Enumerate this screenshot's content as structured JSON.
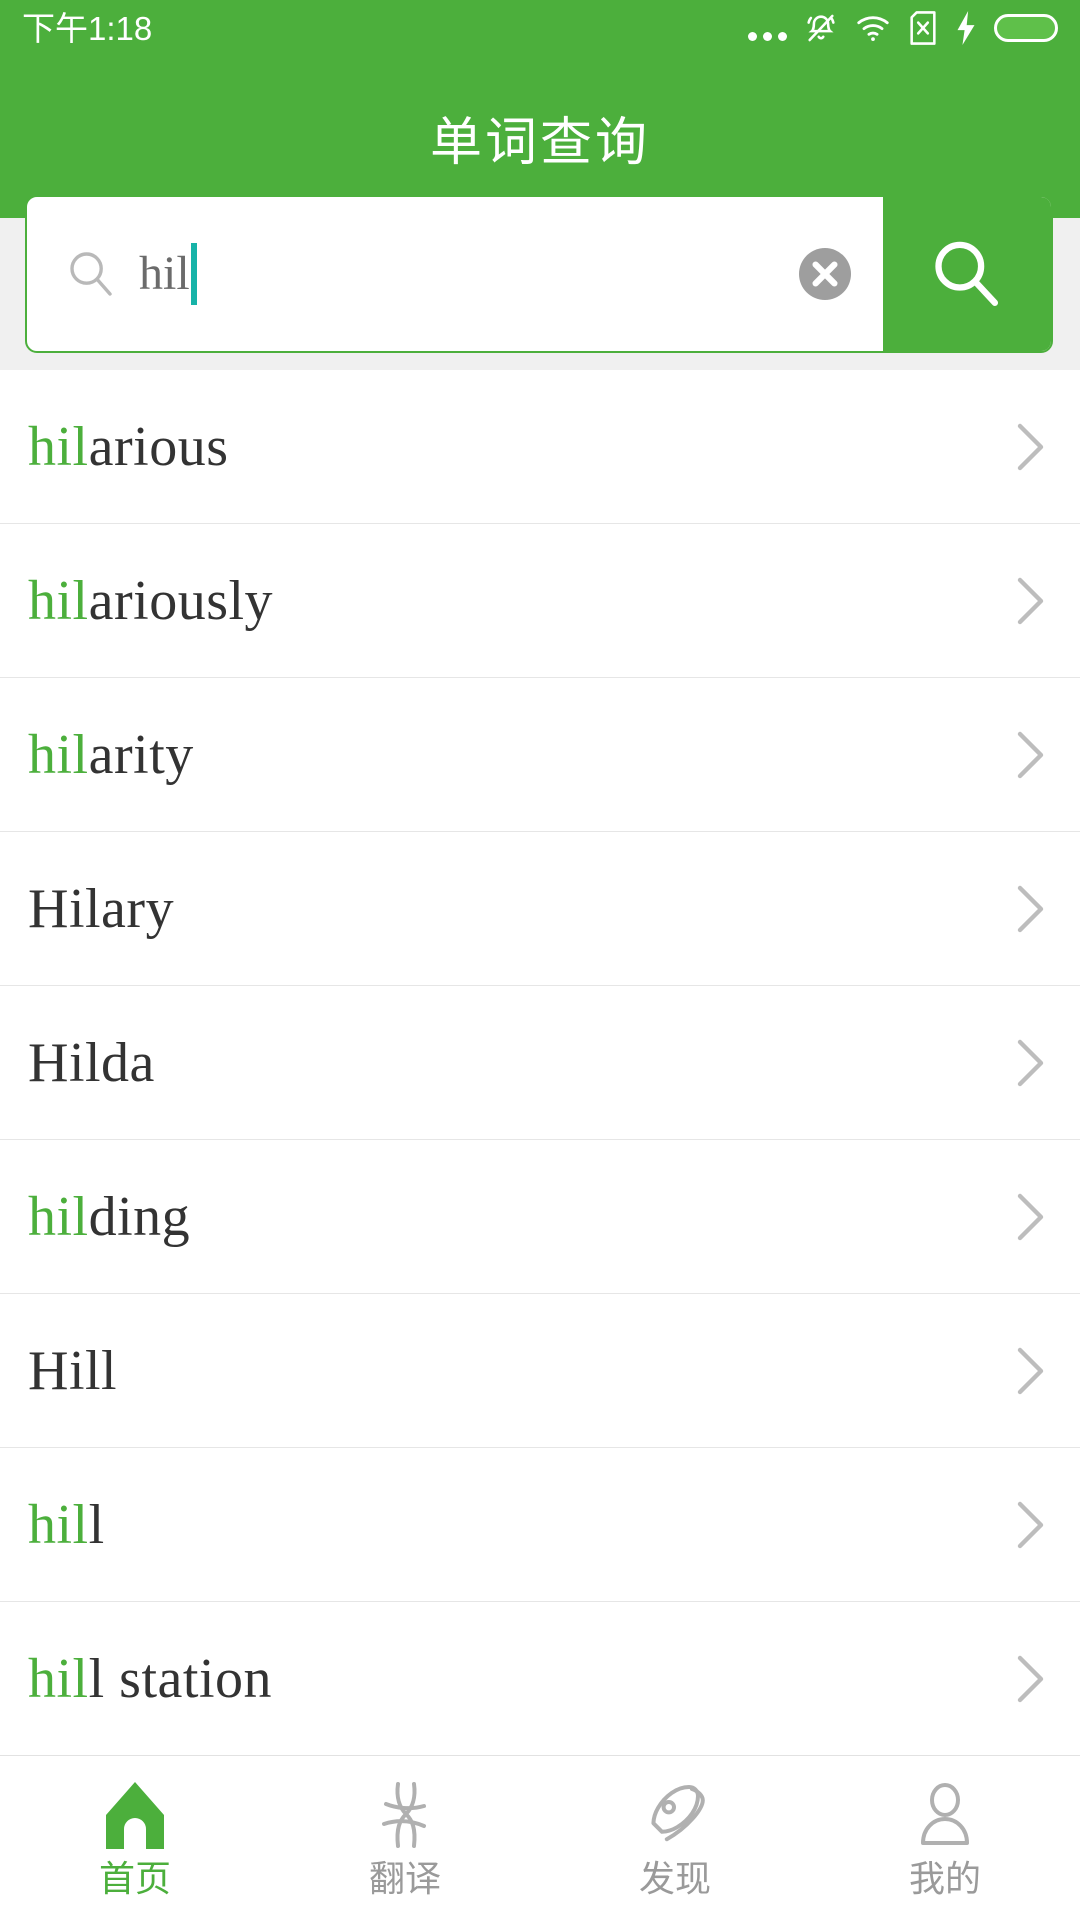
{
  "status_bar": {
    "time": "下午1:18",
    "icons": [
      "more-dots-icon",
      "bell-muted-icon",
      "wifi-icon",
      "sim-card-x-icon",
      "charging-bolt-icon",
      "battery-icon"
    ]
  },
  "header": {
    "title": "单词查询",
    "background_color": "#4CAF3C"
  },
  "search": {
    "value": "hil",
    "placeholder": "",
    "clear_label": "clear",
    "button_label": "search",
    "accent_color": "#4CAF3C",
    "caret_color": "#17b3a8",
    "highlight_color": "#4CAF3C"
  },
  "results": [
    {
      "prefix": "hil",
      "rest": "arious",
      "full": "hilarious"
    },
    {
      "prefix": "hil",
      "rest": "ariously",
      "full": "hilariously"
    },
    {
      "prefix": "hil",
      "rest": "arity",
      "full": "hilarity"
    },
    {
      "prefix": "",
      "rest": "Hilary",
      "full": "Hilary"
    },
    {
      "prefix": "",
      "rest": "Hilda",
      "full": "Hilda"
    },
    {
      "prefix": "hil",
      "rest": "ding",
      "full": "hilding"
    },
    {
      "prefix": "",
      "rest": "Hill",
      "full": "Hill"
    },
    {
      "prefix": "hil",
      "rest": "l",
      "full": "hill"
    },
    {
      "prefix": "hil",
      "rest": "l station",
      "full": "hill station"
    }
  ],
  "tabbar": {
    "items": [
      {
        "label": "首页",
        "icon": "home-icon",
        "active": true
      },
      {
        "label": "翻译",
        "icon": "translate-icon",
        "active": false
      },
      {
        "label": "发现",
        "icon": "rocket-icon",
        "active": false
      },
      {
        "label": "我的",
        "icon": "person-icon",
        "active": false
      }
    ],
    "active_color": "#4CAF3C",
    "inactive_color": "#9a9a9a"
  }
}
